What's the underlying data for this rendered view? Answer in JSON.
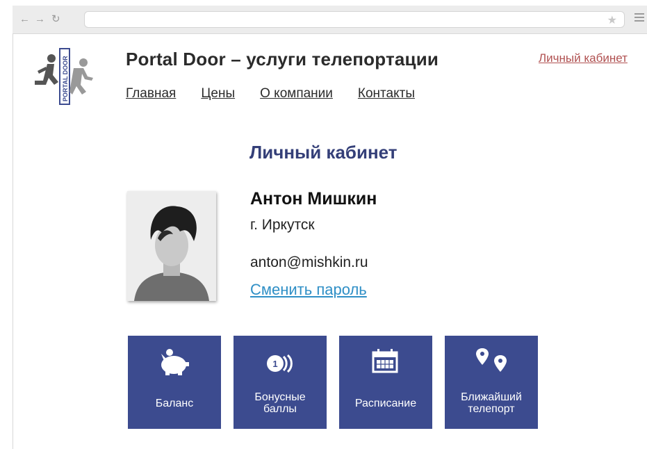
{
  "browser": {
    "back_icon": "arrow-left-icon",
    "forward_icon": "arrow-right-icon",
    "reload_icon": "reload-icon",
    "star_icon": "star-icon",
    "menu_icon": "hamburger-menu-icon"
  },
  "logo": {
    "text": "PORTAL DOOR"
  },
  "header": {
    "title": "Portal Door – услуги телепортации",
    "account_link": "Личный кабинет",
    "nav": [
      "Главная",
      "Цены",
      "О компании",
      "Контакты"
    ]
  },
  "main": {
    "heading": "Личный кабинет",
    "user": {
      "name": "Антон Мишкин",
      "city": "г. Иркутск",
      "email": "anton@mishkin.ru",
      "change_password": "Сменить пароль"
    },
    "tiles": [
      {
        "label": "Баланс",
        "icon": "piggy-bank-icon"
      },
      {
        "label": "Бонусные\nбаллы",
        "icon": "coin-one-icon"
      },
      {
        "label": "Расписание",
        "icon": "calendar-icon"
      },
      {
        "label": "Ближайший\nтелепорт",
        "icon": "map-pins-icon"
      }
    ]
  },
  "colors": {
    "tile_bg": "#3c4b8f",
    "heading": "#343f78",
    "account_link": "#b05151",
    "change_password_link": "#2f8fc6"
  }
}
